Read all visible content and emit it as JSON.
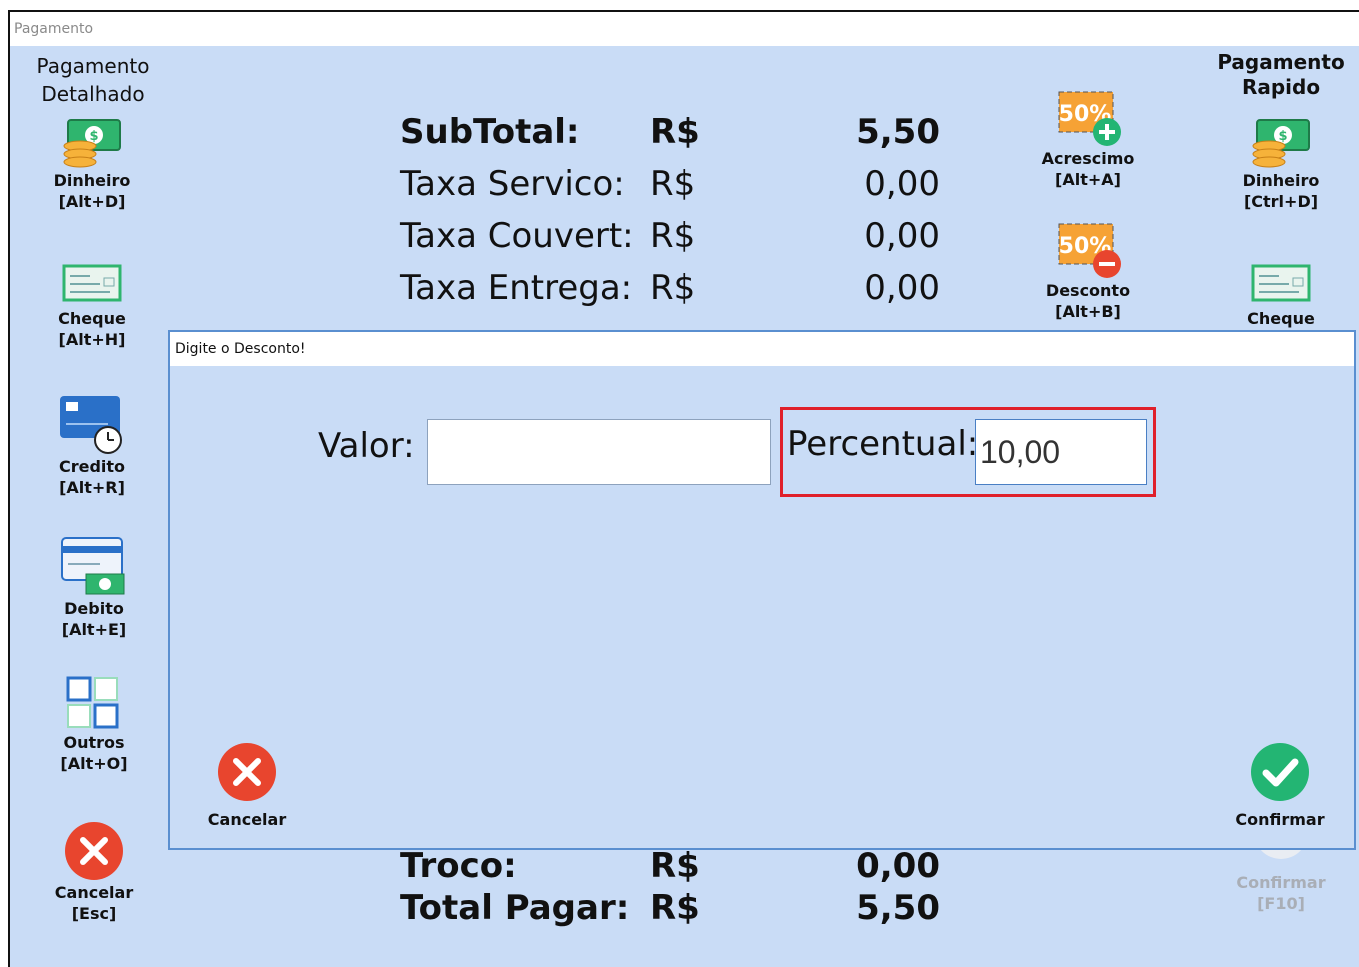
{
  "window": {
    "title": "Pagamento"
  },
  "left_header": {
    "line1": "Pagamento",
    "line2": "Detalhado"
  },
  "right_header": {
    "line1": "Pagamento",
    "line2": "Rapido"
  },
  "left_buttons": [
    {
      "label": "Dinheiro",
      "shortcut": "[Alt+D]",
      "icon": "money-icon"
    },
    {
      "label": "Cheque",
      "shortcut": "[Alt+H]",
      "icon": "check-icon"
    },
    {
      "label": "Credito",
      "shortcut": "[Alt+R]",
      "icon": "credit-card-icon"
    },
    {
      "label": "Debito",
      "shortcut": "[Alt+E]",
      "icon": "debit-card-icon"
    },
    {
      "label": "Outros",
      "shortcut": "[Alt+O]",
      "icon": "grid-icon"
    },
    {
      "label": "Cancelar",
      "shortcut": "[Esc]",
      "icon": "cancel-icon"
    }
  ],
  "right_buttons": [
    {
      "label": "Dinheiro",
      "shortcut": "[Ctrl+D]",
      "icon": "money-icon"
    },
    {
      "label": "Cheque",
      "icon": "check-icon"
    },
    {
      "label": "Confirmar",
      "shortcut": "[F10]",
      "icon": "confirm-icon"
    }
  ],
  "adjust_buttons": [
    {
      "badge": "50%",
      "label": "Acrescimo",
      "shortcut": "[Alt+A]",
      "icon": "percent-plus-icon"
    },
    {
      "badge": "50%",
      "label": "Desconto",
      "shortcut": "[Alt+B]",
      "icon": "percent-minus-icon"
    }
  ],
  "totals": [
    {
      "label": "SubTotal:",
      "currency": "R$",
      "value": "5,50",
      "bold": true
    },
    {
      "label": "Taxa Servico:",
      "currency": "R$",
      "value": "0,00",
      "bold": false
    },
    {
      "label": "Taxa Couvert:",
      "currency": "R$",
      "value": "0,00",
      "bold": false
    },
    {
      "label": "Taxa Entrega:",
      "currency": "R$",
      "value": "0,00",
      "bold": false
    }
  ],
  "bottom_totals": [
    {
      "label": "Troco:",
      "currency": "R$",
      "value": "0,00"
    },
    {
      "label": "Total Pagar:",
      "currency": "R$",
      "value": "5,50"
    }
  ],
  "dialog": {
    "title": "Digite o Desconto!",
    "valor_label": "Valor:",
    "valor_value": "",
    "percentual_label": "Percentual:",
    "percentual_value": "10,00",
    "cancel_label": "Cancelar",
    "confirm_label": "Confirmar"
  },
  "colors": {
    "background": "#c9dcf6",
    "highlight": "#e0202a",
    "cancel": "#e8452e",
    "confirm": "#23b573",
    "money": "#2fb56e",
    "badge": "#f6a235"
  }
}
